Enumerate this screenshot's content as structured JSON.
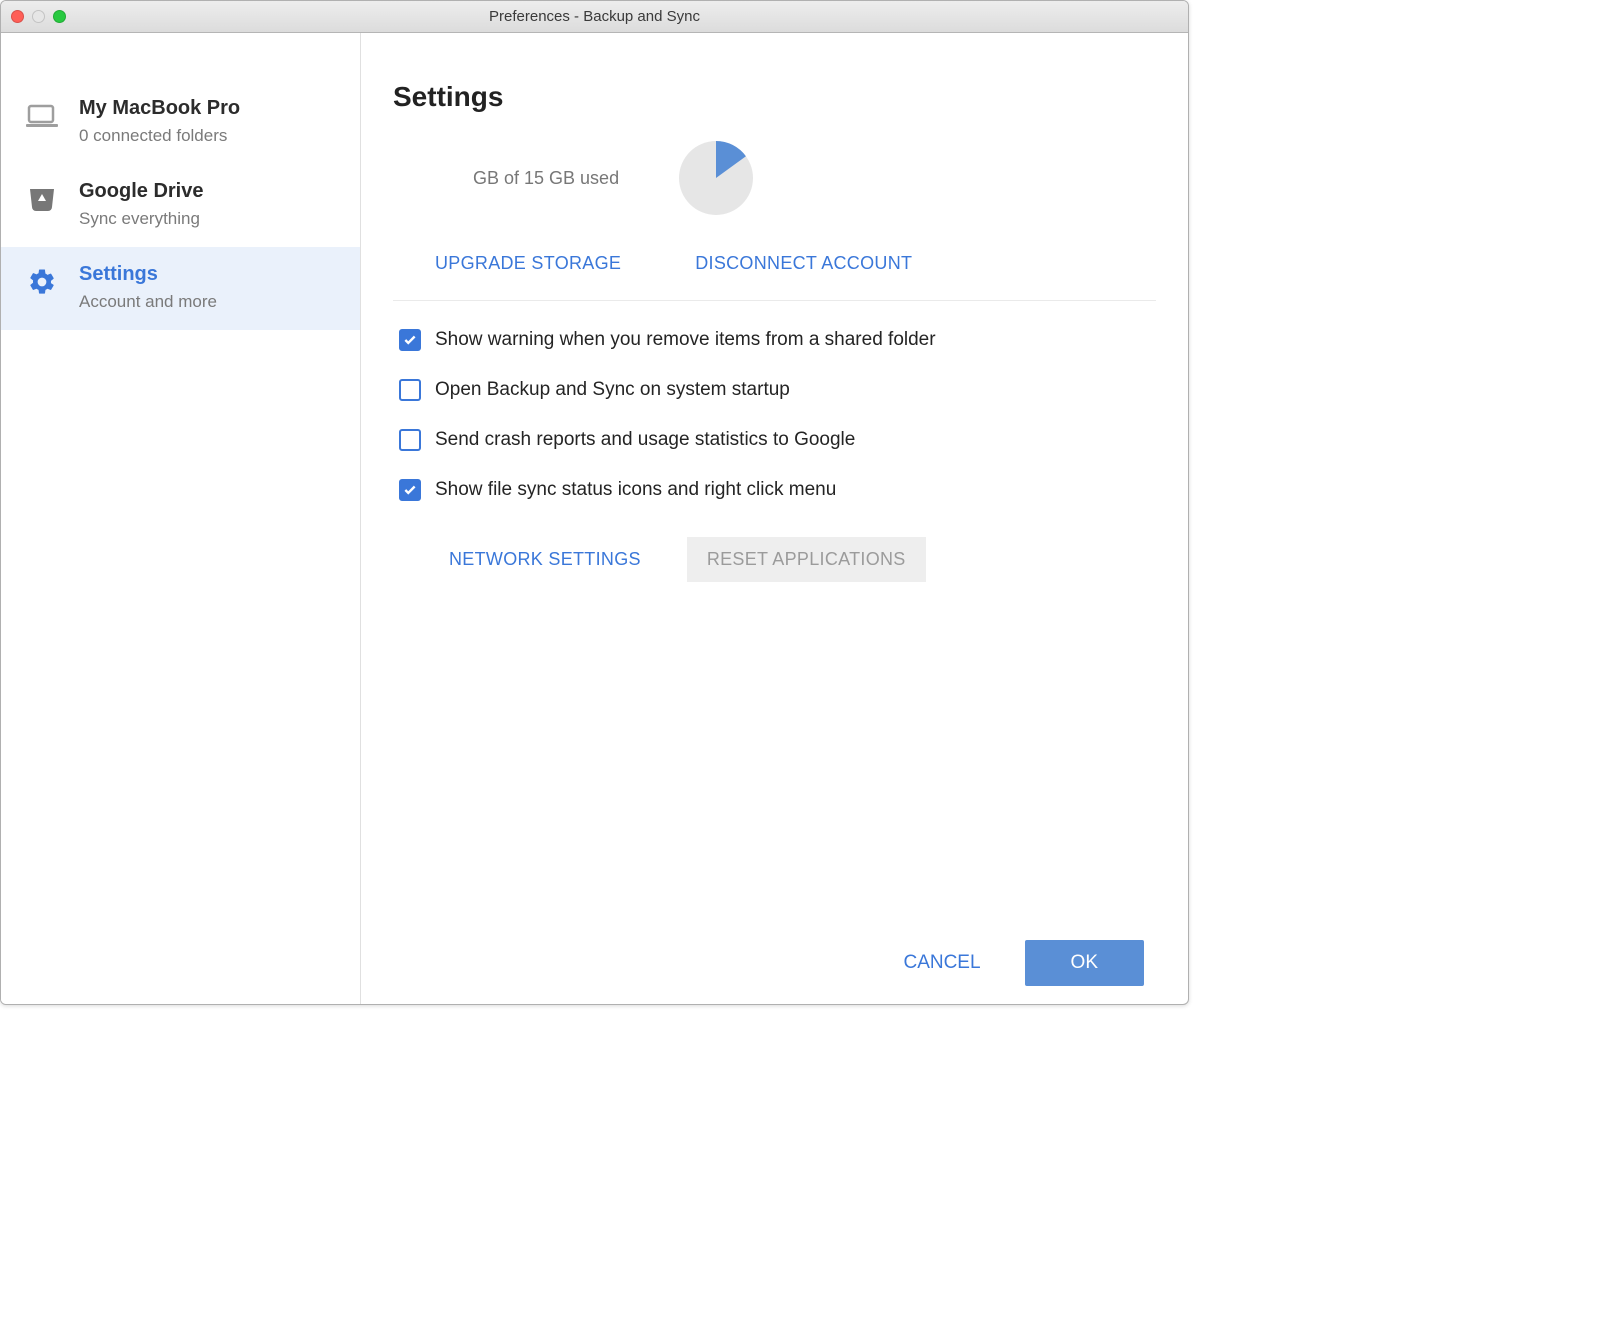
{
  "window": {
    "title": "Preferences - Backup and Sync"
  },
  "sidebar": {
    "items": [
      {
        "title": "My MacBook Pro",
        "subtitle": "0 connected folders"
      },
      {
        "title": "Google Drive",
        "subtitle": "Sync everything"
      },
      {
        "title": "Settings",
        "subtitle": "Account and more"
      }
    ]
  },
  "main": {
    "page_title": "Settings",
    "storage_text": "GB of 15 GB used",
    "upgrade_label": "UPGRADE STORAGE",
    "disconnect_label": "DISCONNECT ACCOUNT",
    "checkboxes": [
      {
        "label": "Show warning when you remove items from a shared folder",
        "checked": true
      },
      {
        "label": "Open Backup and Sync on system startup",
        "checked": false
      },
      {
        "label": "Send crash reports and usage statistics to Google",
        "checked": false
      },
      {
        "label": "Show file sync status icons and right click menu",
        "checked": true
      }
    ],
    "network_label": "NETWORK SETTINGS",
    "reset_label": "RESET APPLICATIONS",
    "cancel_label": "CANCEL",
    "ok_label": "OK"
  },
  "chart_data": {
    "type": "pie",
    "title": "",
    "values": [
      {
        "name": "used",
        "value": 15,
        "color": "#5a8fd6"
      },
      {
        "name": "free",
        "value": 85,
        "color": "#e6e6e6"
      }
    ]
  }
}
